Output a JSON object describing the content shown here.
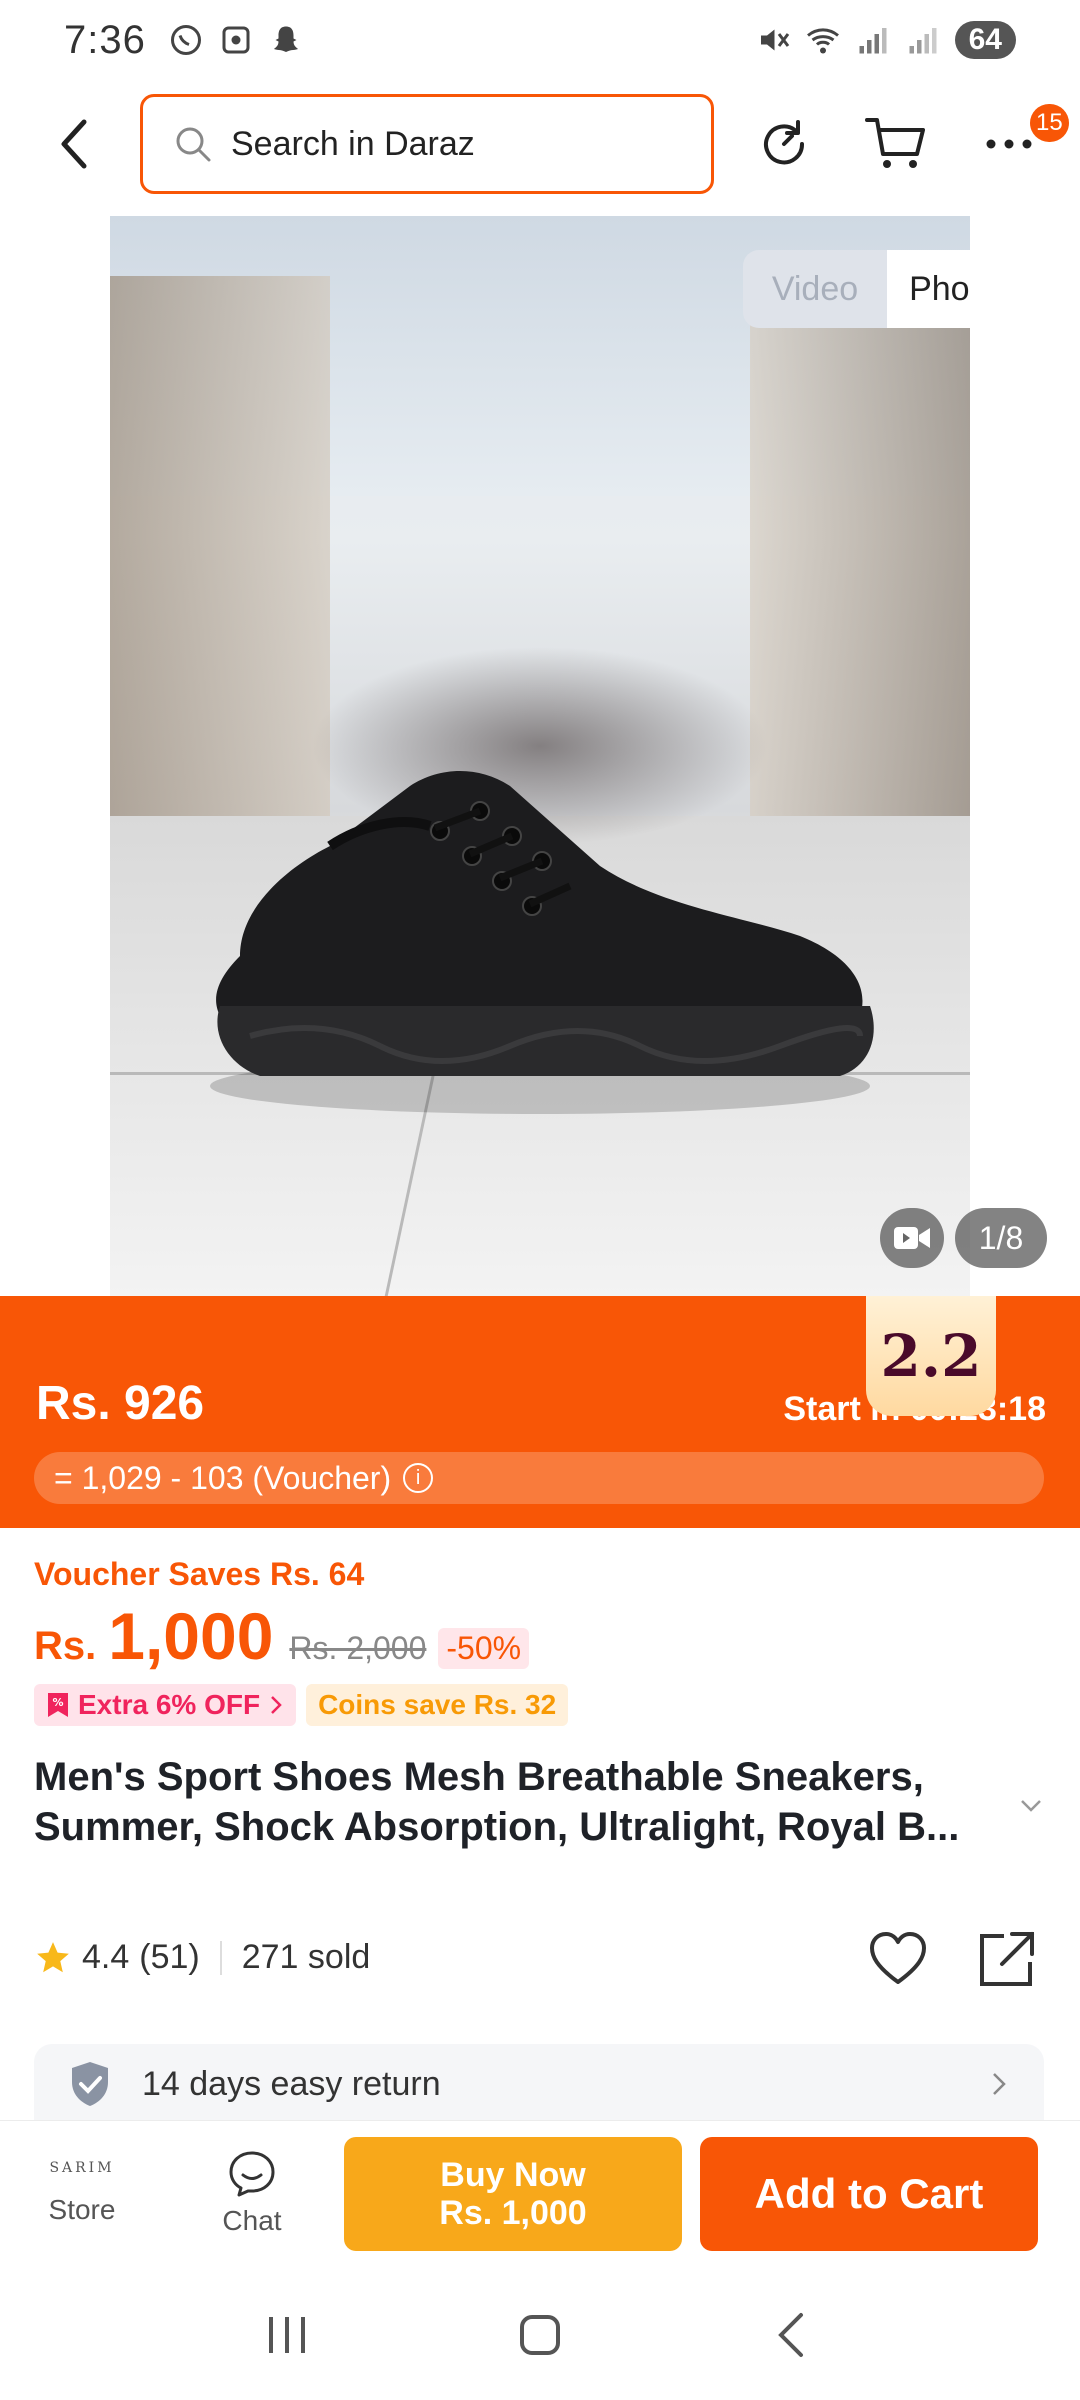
{
  "status_bar": {
    "time": "7:36",
    "battery": "64"
  },
  "search": {
    "placeholder": "Search in Daraz"
  },
  "header": {
    "notification_count": "15"
  },
  "media": {
    "video_tab": "Video",
    "photos_tab": "Photos",
    "active_tab": "Photos",
    "counter": "1/8"
  },
  "flash_sale": {
    "price": "Rs. 926",
    "countdown": "Start in 00:23:18",
    "voucher_formula": "= 1,029 - 103 (Voucher)",
    "badge": "2.2"
  },
  "pricing": {
    "voucher_saves": "Voucher Saves Rs. 64",
    "currency": "Rs.",
    "price": "1,000",
    "original_price": "Rs. 2,000",
    "discount": "-50%",
    "extra_off": "Extra 6% OFF",
    "coins_save": "Coins save Rs. 32"
  },
  "product": {
    "title": "Men's Sport Shoes Mesh Breathable Sneakers, Summer, Shock Absorption, Ultralight, Royal B..."
  },
  "rating": {
    "score": "4.4",
    "count": "(51)",
    "sold": "271 sold"
  },
  "service": {
    "return_policy": "14 days easy return"
  },
  "bottom_bar": {
    "store_brand": "SARIM",
    "store_label": "Store",
    "chat_label": "Chat",
    "buy_now_label": "Buy Now",
    "buy_now_price": "Rs. 1,000",
    "add_to_cart_label": "Add to Cart"
  },
  "colors": {
    "accent": "#f85606",
    "buy_now": "#f8a81a",
    "rating_star": "#f8b81a"
  }
}
